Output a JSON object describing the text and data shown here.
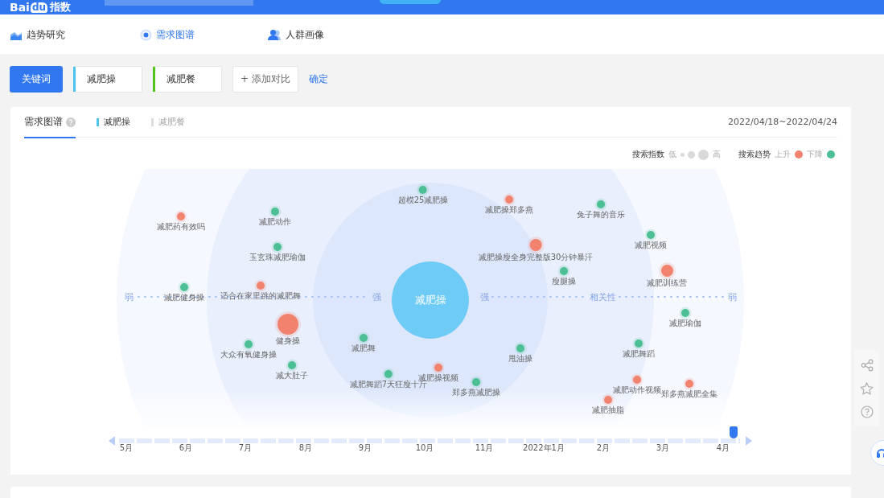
{
  "header": {
    "brand": "Bai",
    "brand_mark": "du",
    "product": "指数"
  },
  "nav": {
    "tabs": [
      {
        "label": "趋势研究",
        "selected": false
      },
      {
        "label": "需求图谱",
        "selected": true
      },
      {
        "label": "人群画像",
        "selected": false
      }
    ]
  },
  "keywords": {
    "label": "关键词",
    "items": [
      {
        "text": "减肥操",
        "color": "#4fc3f0"
      },
      {
        "text": "减肥餐",
        "color": "#52c41a"
      }
    ],
    "add": "+ 添加对比",
    "confirm": "确定"
  },
  "card": {
    "title": "需求图谱",
    "keyword_tabs": [
      {
        "label": "减肥操",
        "selected": true
      },
      {
        "label": "减肥餐",
        "selected": false
      }
    ],
    "date_range": "2022/04/18~2022/04/24"
  },
  "legend": {
    "index_label": "搜索指数",
    "low": "低",
    "high": "高",
    "trend_label": "搜索趋势",
    "up": "上升",
    "down": "下降"
  },
  "graph": {
    "center": "减肥操",
    "axis": {
      "left": "弱",
      "left_inner": "强",
      "right_inner": "强",
      "middle": "相关性",
      "right": "弱"
    },
    "nodes": [
      {
        "label": "超模25减肥操",
        "color": "#4cbf94",
        "kind": "small"
      },
      {
        "label": "减肥操郑多燕",
        "color": "#f0826e",
        "kind": "small"
      },
      {
        "label": "兔子舞的音乐",
        "color": "#4cbf94",
        "kind": "small"
      },
      {
        "label": "减肥药有效吗",
        "color": "#f0826e",
        "kind": "small"
      },
      {
        "label": "减肥动作",
        "color": "#4cbf94",
        "kind": "small"
      },
      {
        "label": "减肥视频",
        "color": "#4cbf94",
        "kind": "small"
      },
      {
        "label": "玉玄珠减肥瑜伽",
        "color": "#4cbf94",
        "kind": "small"
      },
      {
        "label": "减肥操瘦全身完整版30分钟暴汗",
        "color": "#f0826e",
        "kind": "medium"
      },
      {
        "label": "瘦腿操",
        "color": "#4cbf94",
        "kind": "small"
      },
      {
        "label": "减肥训练营",
        "color": "#f0826e",
        "kind": "medium"
      },
      {
        "label": "减肥健身操",
        "color": "#4cbf94",
        "kind": "small"
      },
      {
        "label": "适合在家里跳的减肥舞",
        "color": "#f0826e",
        "kind": "small"
      },
      {
        "label": "减肥瑜伽",
        "color": "#4cbf94",
        "kind": "small"
      },
      {
        "label": "健身操",
        "color": "#f0826e",
        "kind": "large"
      },
      {
        "label": "减肥舞",
        "color": "#4cbf94",
        "kind": "small"
      },
      {
        "label": "减肥舞蹈",
        "color": "#4cbf94",
        "kind": "small"
      },
      {
        "label": "大众有氧健身操",
        "color": "#4cbf94",
        "kind": "small"
      },
      {
        "label": "甩油操",
        "color": "#4cbf94",
        "kind": "small"
      },
      {
        "label": "减大肚子",
        "color": "#4cbf94",
        "kind": "small"
      },
      {
        "label": "减肥舞蹈7天狂瘦十斤",
        "color": "#4cbf94",
        "kind": "small"
      },
      {
        "label": "减肥操视频",
        "color": "#f0826e",
        "kind": "small"
      },
      {
        "label": "郑多燕减肥操",
        "color": "#4cbf94",
        "kind": "small"
      },
      {
        "label": "减肥动作视频",
        "color": "#f0826e",
        "kind": "small"
      },
      {
        "label": "郑多燕减肥全集",
        "color": "#f0826e",
        "kind": "small"
      },
      {
        "label": "减肥抽脂",
        "color": "#f0826e",
        "kind": "small"
      }
    ]
  },
  "timeline": {
    "level": 0.99,
    "months": [
      "5月",
      "6月",
      "7月",
      "8月",
      "9月",
      "10月",
      "11月",
      "2022年1月",
      "2月",
      "3月",
      "4月"
    ]
  }
}
